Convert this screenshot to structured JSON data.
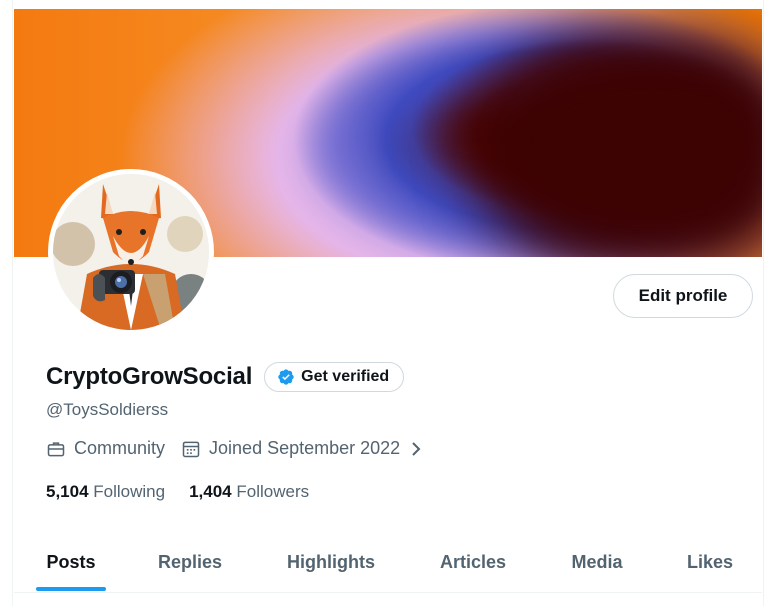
{
  "profile": {
    "display_name": "CryptoGrowSocial",
    "handle": "@ToysSoldierss",
    "get_verified_label": "Get verified",
    "edit_profile_label": "Edit profile",
    "category": "Community",
    "joined": "Joined September 2022"
  },
  "stats": {
    "following_count": "5,104",
    "following_label": "Following",
    "followers_count": "1,404",
    "followers_label": "Followers"
  },
  "tabs": [
    {
      "label": "Posts",
      "active": true
    },
    {
      "label": "Replies"
    },
    {
      "label": "Highlights"
    },
    {
      "label": "Articles"
    },
    {
      "label": "Media"
    },
    {
      "label": "Likes"
    }
  ],
  "icons": {
    "verified_badge": "verified-badge-icon",
    "category": "briefcase-icon",
    "joined": "calendar-icon",
    "more": "chevron-right-icon"
  },
  "colors": {
    "accent": "#1d9bf0",
    "text": "#0f1419",
    "secondary_text": "#536471"
  }
}
